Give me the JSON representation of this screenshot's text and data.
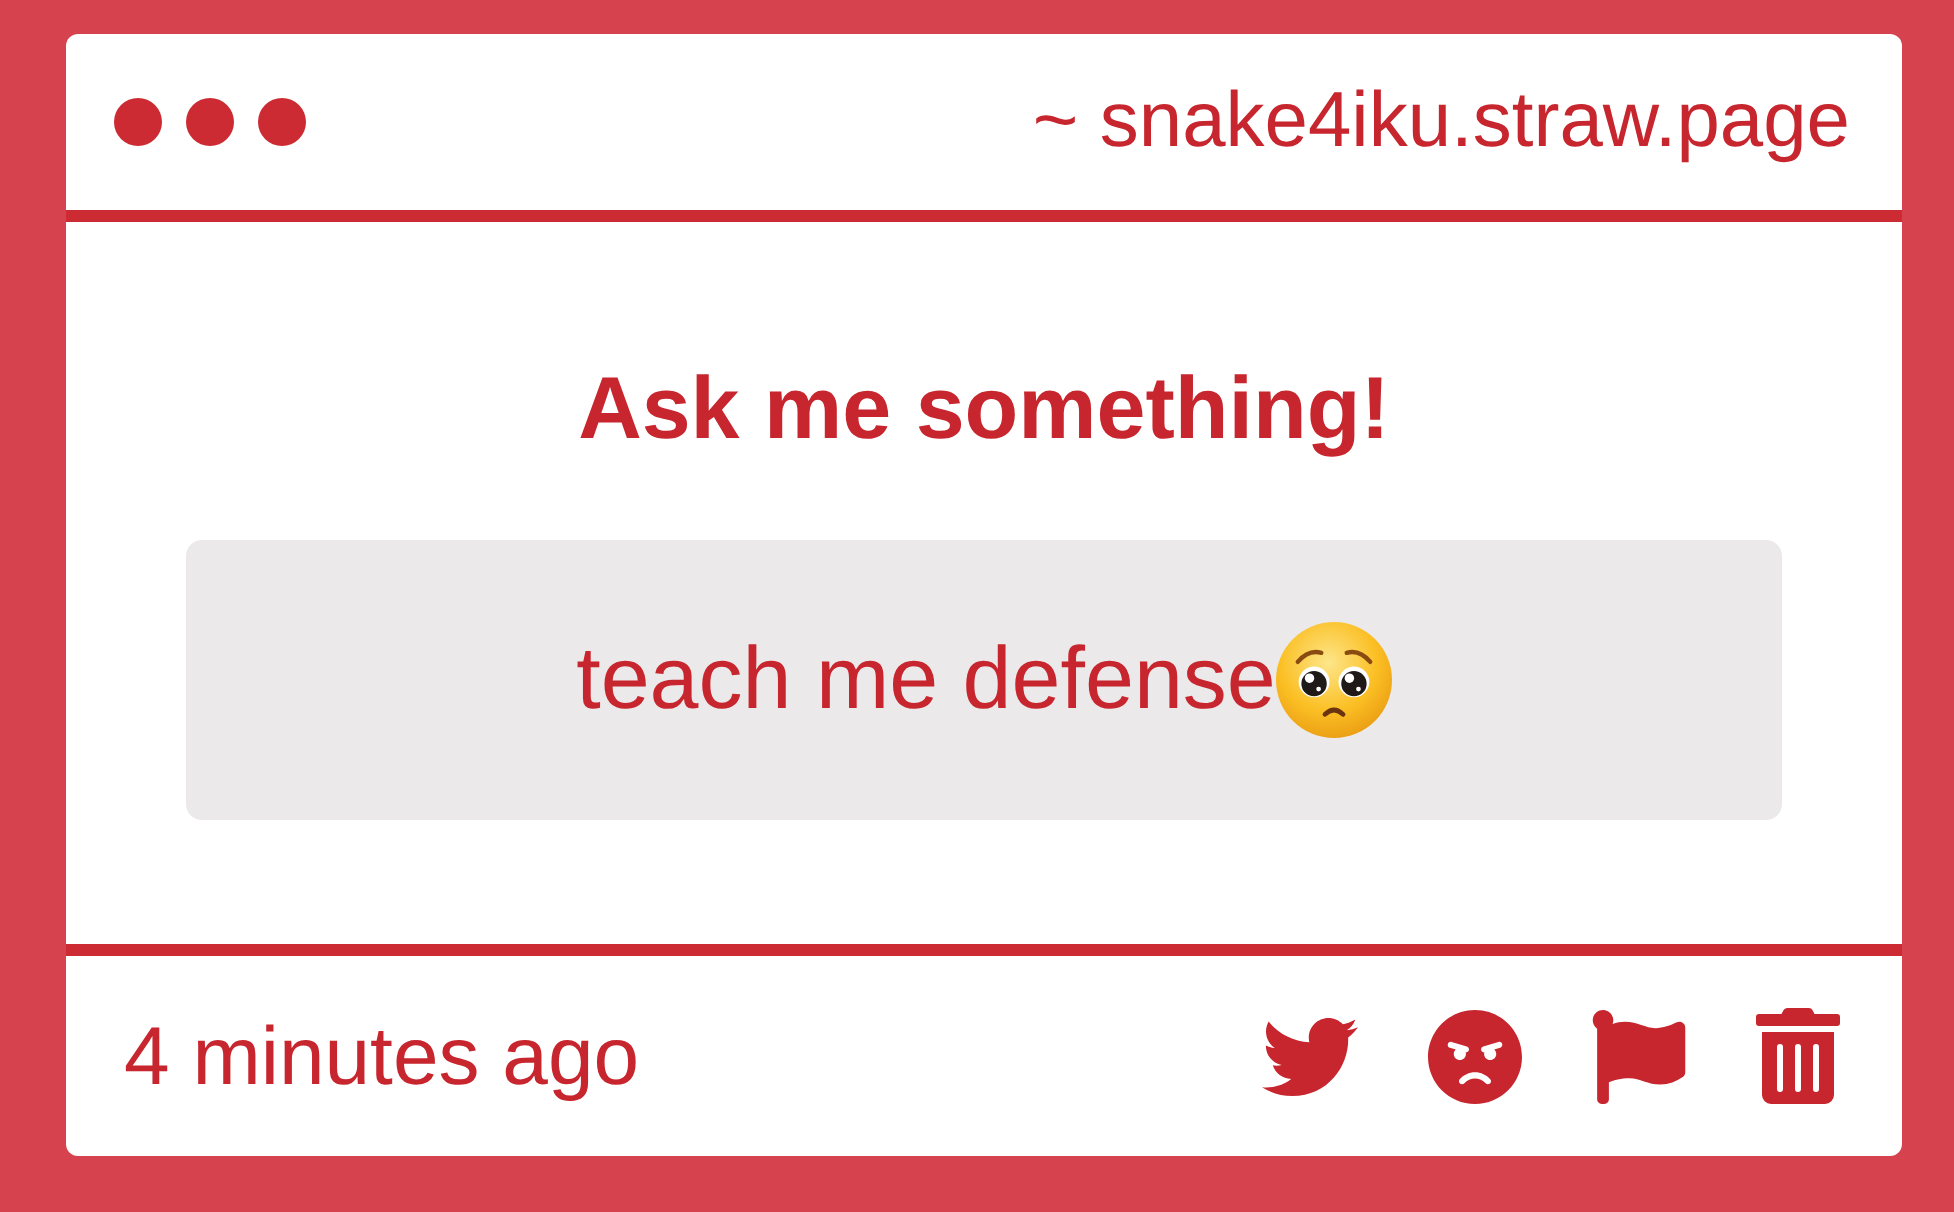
{
  "window": {
    "address": "~ snake4iku.straw.page"
  },
  "prompt": {
    "title": "Ask me something!",
    "question": "teach me defense"
  },
  "footer": {
    "time": "4 minutes ago"
  }
}
